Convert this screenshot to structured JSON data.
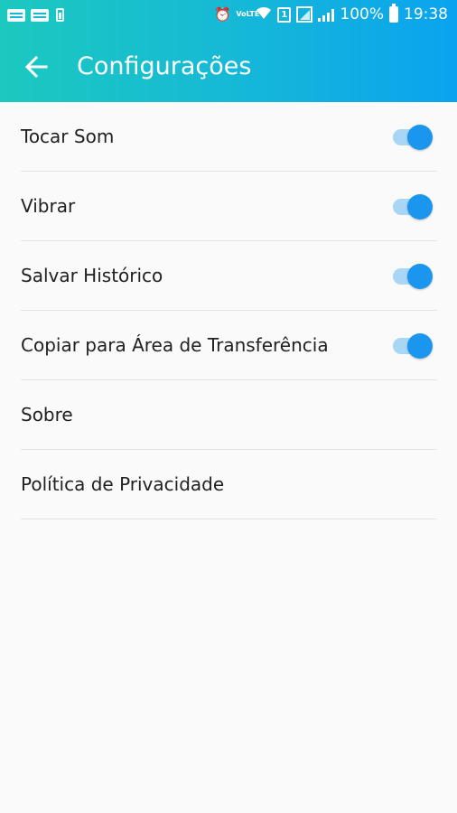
{
  "status_bar": {
    "battery_percent": "100%",
    "time": "19:38",
    "lte_label": "VoLTE",
    "sim_label": "1"
  },
  "app_bar": {
    "title": "Configurações",
    "back_icon": "arrow-left-icon"
  },
  "settings": [
    {
      "label": "Tocar Som",
      "toggle": true,
      "on": true
    },
    {
      "label": "Vibrar",
      "toggle": true,
      "on": true
    },
    {
      "label": "Salvar Histórico",
      "toggle": true,
      "on": true
    },
    {
      "label": "Copiar para Área de Transferência",
      "toggle": true,
      "on": true
    },
    {
      "label": "Sobre",
      "toggle": false
    },
    {
      "label": "Política de Privacidade",
      "toggle": false
    }
  ],
  "colors": {
    "header_gradient_start": "#1bc9bf",
    "header_gradient_end": "#0aa3ef",
    "toggle_thumb": "#1a96ee",
    "toggle_track": "#a8d6f4",
    "background": "#fafafa"
  }
}
